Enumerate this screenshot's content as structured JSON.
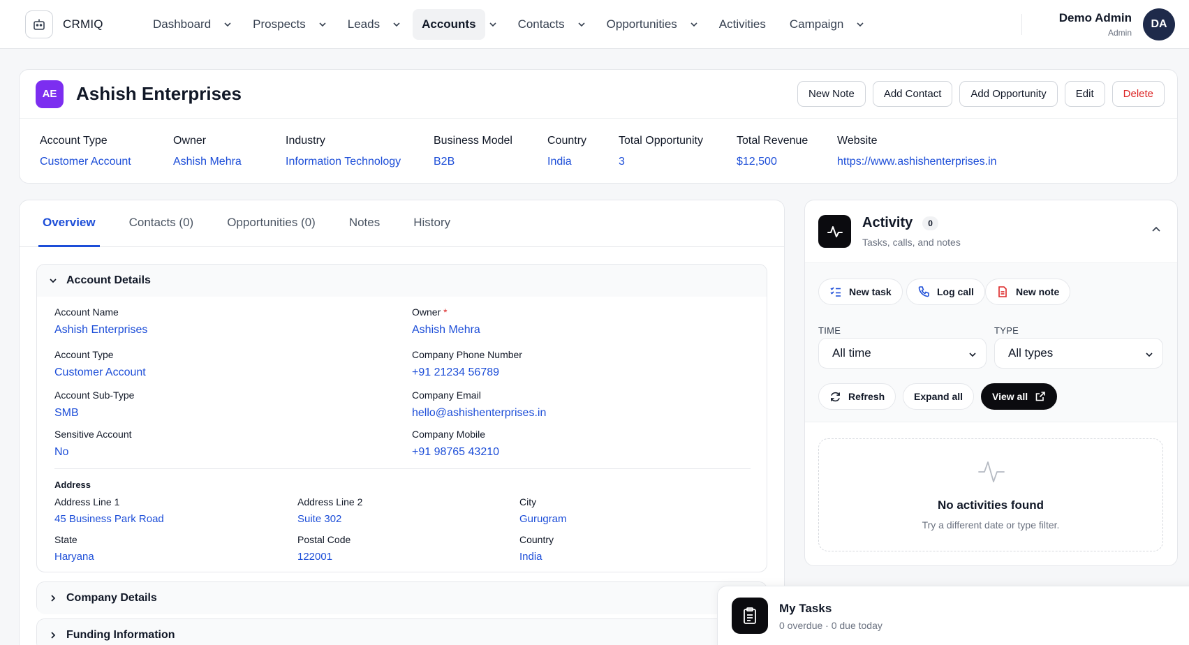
{
  "app": {
    "name": "CRMIQ"
  },
  "nav": {
    "items": [
      {
        "label": "Dashboard",
        "dropdown": true
      },
      {
        "label": "Prospects",
        "dropdown": true
      },
      {
        "label": "Leads",
        "dropdown": true
      },
      {
        "label": "Accounts",
        "dropdown": true,
        "active": true
      },
      {
        "label": "Contacts",
        "dropdown": true
      },
      {
        "label": "Opportunities",
        "dropdown": true
      },
      {
        "label": "Activities",
        "dropdown": false
      },
      {
        "label": "Campaign",
        "dropdown": true
      }
    ]
  },
  "user": {
    "name": "Demo Admin",
    "role": "Admin",
    "initials": "DA"
  },
  "account": {
    "initials": "AE",
    "name": "Ashish Enterprises",
    "actions": {
      "new_note": "New Note",
      "add_contact": "Add Contact",
      "add_opportunity": "Add Opportunity",
      "edit": "Edit",
      "delete": "Delete"
    },
    "summary": [
      {
        "label": "Account Type",
        "value": "Customer Account"
      },
      {
        "label": "Owner",
        "value": "Ashish Mehra"
      },
      {
        "label": "Industry",
        "value": "Information Technology"
      },
      {
        "label": "Business Model",
        "value": "B2B"
      },
      {
        "label": "Country",
        "value": "India"
      },
      {
        "label": "Total Opportunity",
        "value": "3"
      },
      {
        "label": "Total Revenue",
        "value": "$12,500"
      },
      {
        "label": "Website",
        "value": "https://www.ashishenterprises.in"
      }
    ]
  },
  "tabs": [
    "Overview",
    "Contacts (0)",
    "Opportunities (0)",
    "Notes",
    "History"
  ],
  "details": {
    "title": "Account Details",
    "account_name": {
      "label": "Account Name",
      "value": "Ashish Enterprises"
    },
    "owner": {
      "label": "Owner",
      "required": "*",
      "value": "Ashish Mehra"
    },
    "account_type": {
      "label": "Account Type",
      "value": "Customer Account"
    },
    "company_phone": {
      "label": "Company Phone Number",
      "value": "+91 21234 56789"
    },
    "account_subtype": {
      "label": "Account Sub-Type",
      "value": "SMB"
    },
    "company_email": {
      "label": "Company Email",
      "value": "hello@ashishenterprises.in"
    },
    "sensitive": {
      "label": "Sensitive Account",
      "value": "No"
    },
    "company_mobile": {
      "label": "Company Mobile",
      "value": "+91 98765 43210"
    },
    "address": {
      "title": "Address",
      "line1": {
        "label": "Address Line 1",
        "value": "45 Business Park Road"
      },
      "line2": {
        "label": "Address Line 2",
        "value": "Suite 302"
      },
      "city": {
        "label": "City",
        "value": "Gurugram"
      },
      "state": {
        "label": "State",
        "value": "Haryana"
      },
      "postal": {
        "label": "Postal Code",
        "value": "122001"
      },
      "country": {
        "label": "Country",
        "value": "India"
      }
    }
  },
  "sections": {
    "company": "Company Details",
    "funding": "Funding Information"
  },
  "activity": {
    "title": "Activity",
    "count": "0",
    "subtitle": "Tasks, calls, and notes",
    "new_task": "New task",
    "log_call": "Log call",
    "new_note": "New note",
    "time_label": "TIME",
    "time_value": "All time",
    "type_label": "TYPE",
    "type_value": "All types",
    "refresh": "Refresh",
    "expand_all": "Expand all",
    "view_all": "View all",
    "empty_title": "No activities found",
    "empty_sub": "Try a different date or type filter."
  },
  "tasks": {
    "title": "My Tasks",
    "subtitle": "0 overdue · 0 due today"
  },
  "colors": {
    "accent": "#1d4ed8",
    "badge": "#7c2ef0",
    "danger": "#dc2626",
    "dark": "#0b0b0f"
  }
}
